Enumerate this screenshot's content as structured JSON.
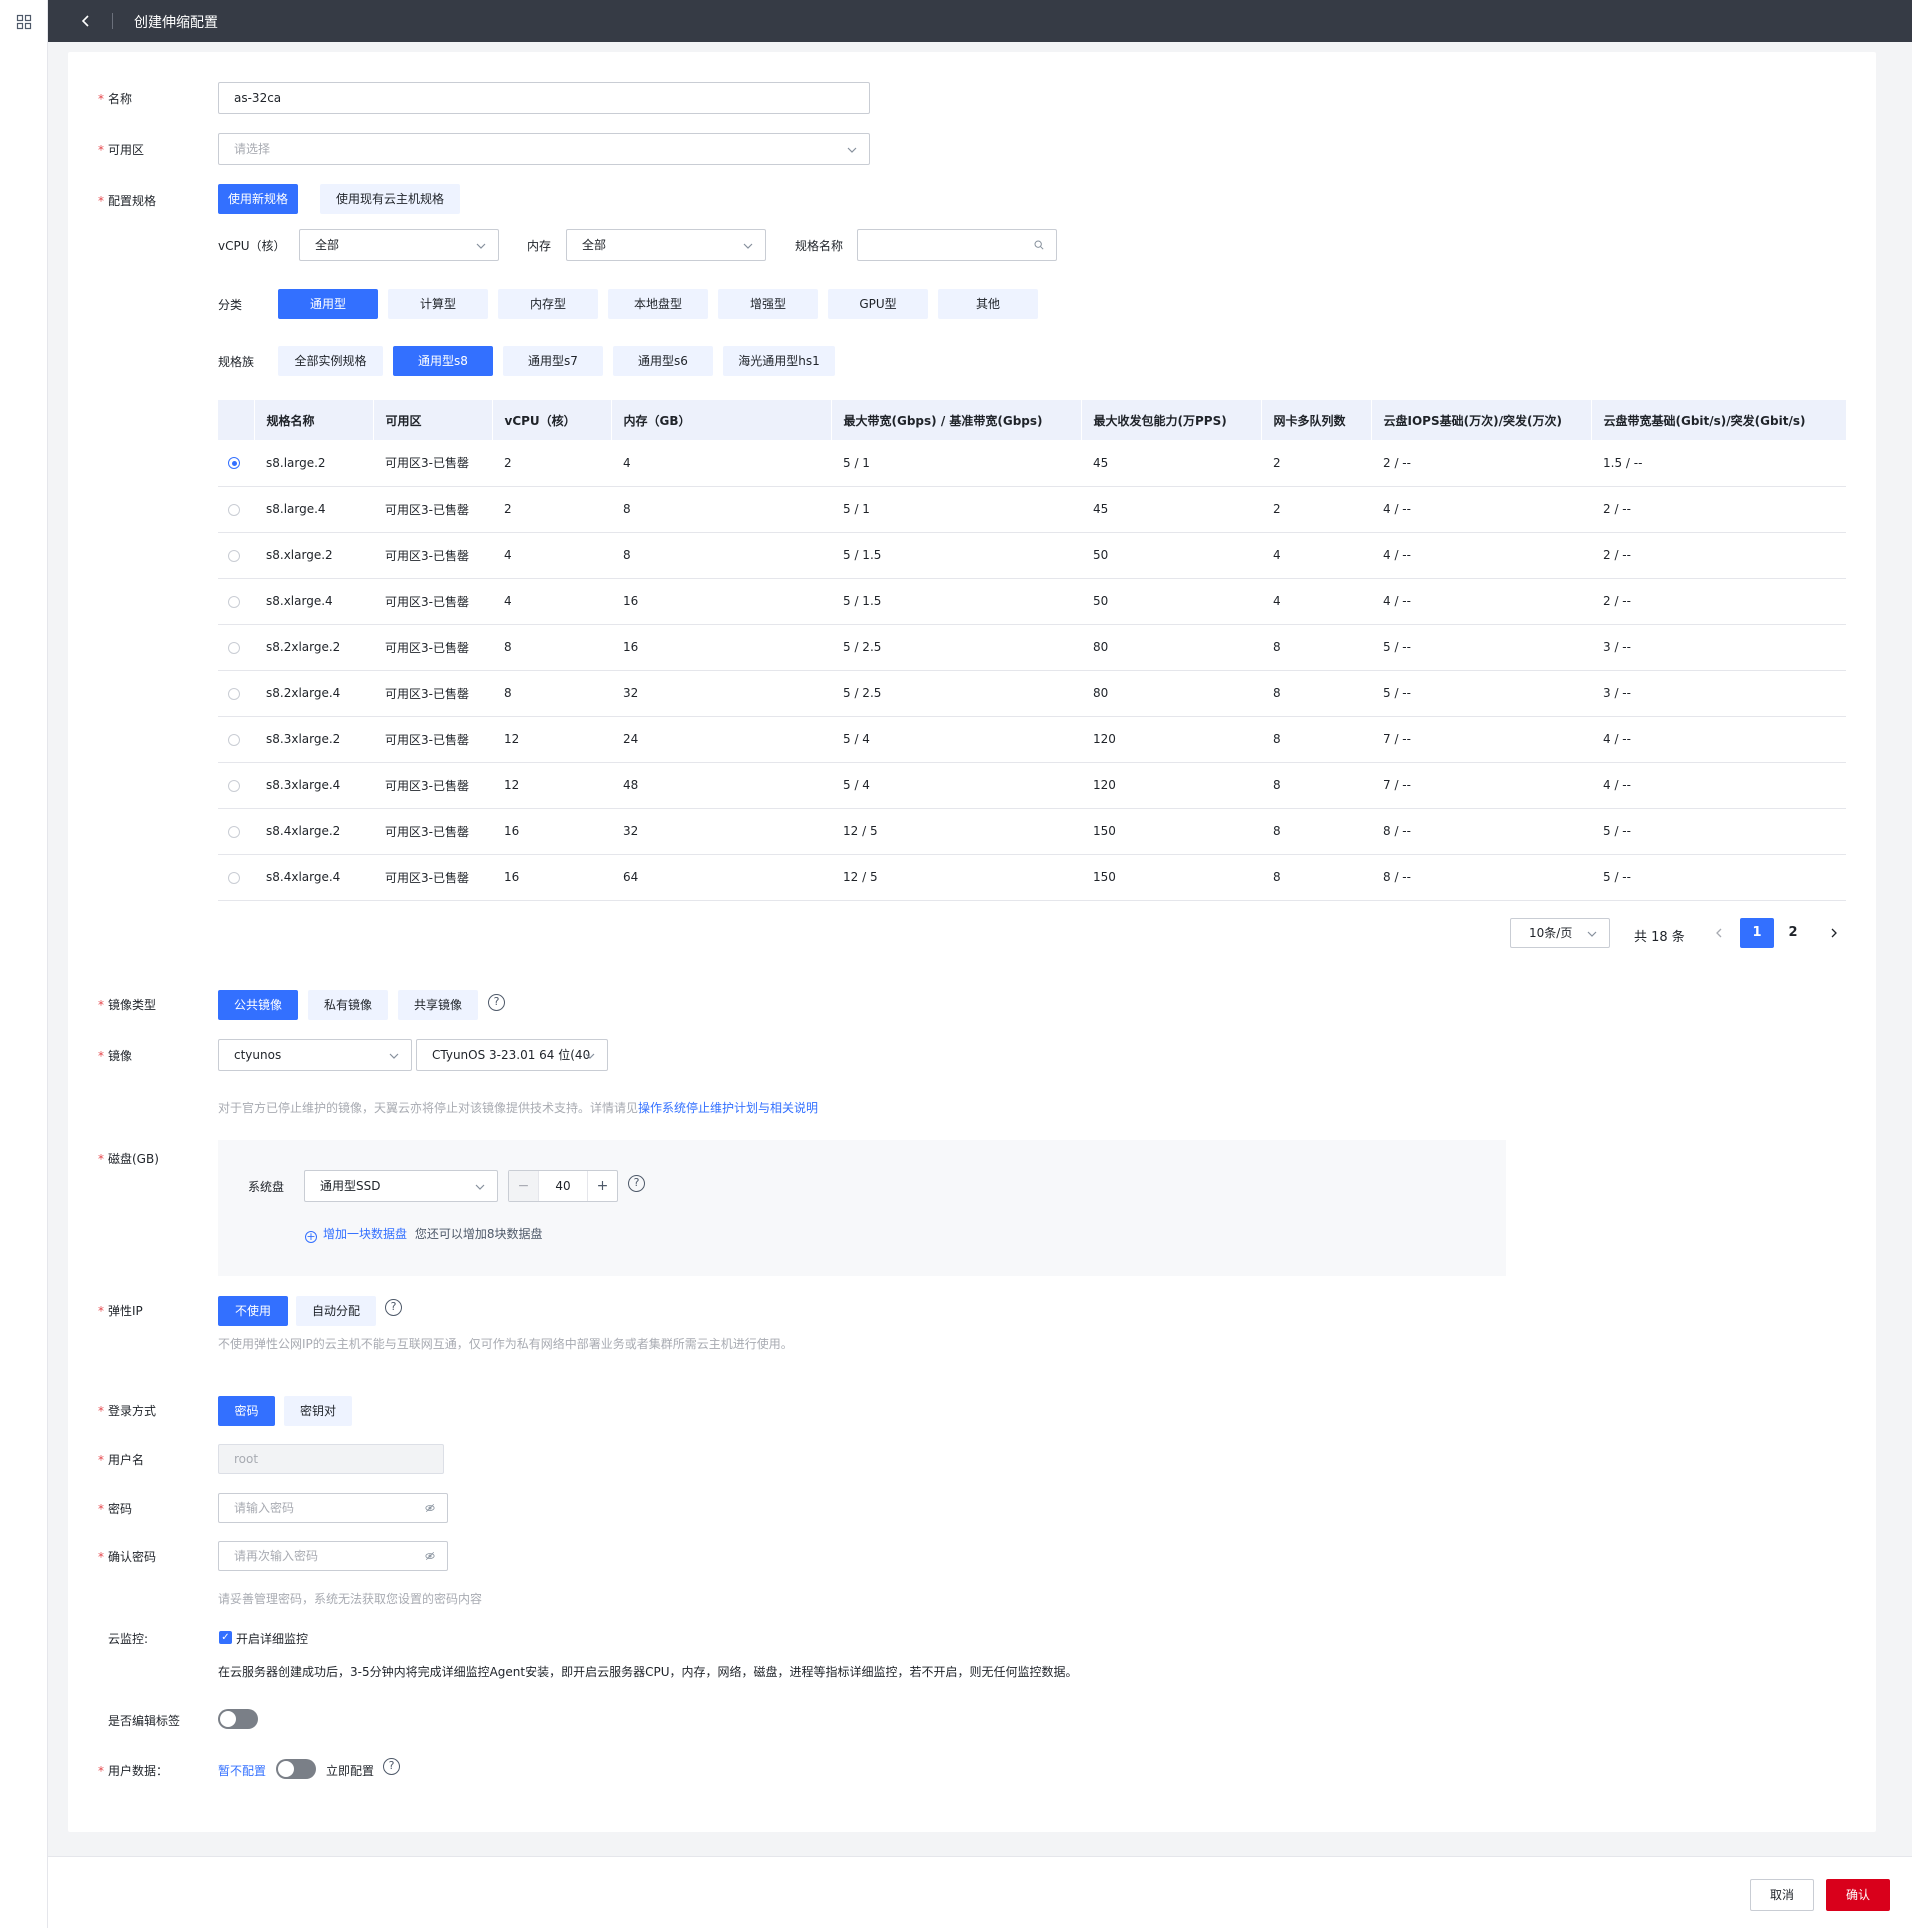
{
  "topbar": {
    "title": "创建伸缩配置"
  },
  "form": {
    "name_label": "名称",
    "name_value": "as-32ca",
    "zone_label": "可用区",
    "zone_placeholder": "请选择",
    "spec_label": "配置规格",
    "spec_modes": [
      "使用新规格",
      "使用现有云主机规格"
    ],
    "filters": {
      "vcpu_label": "vCPU（核）",
      "vcpu_value": "全部",
      "mem_label": "内存",
      "mem_value": "全部",
      "specname_label": "规格名称"
    },
    "category_label": "分类",
    "categories": [
      "通用型",
      "计算型",
      "内存型",
      "本地盘型",
      "增强型",
      "GPU型",
      "其他"
    ],
    "family_label": "规格族",
    "families": [
      "全部实例规格",
      "通用型s8",
      "通用型s7",
      "通用型s6",
      "海光通用型hs1"
    ]
  },
  "table": {
    "headers": [
      "规格名称",
      "可用区",
      "vCPU（核）",
      "内存（GB）",
      "最大带宽(Gbps) / 基准带宽(Gbps)",
      "最大收发包能力(万PPS)",
      "网卡多队列数",
      "云盘IOPS基础(万次)/突发(万次)",
      "云盘带宽基础(Gbit/s)/突发(Gbit/s)"
    ],
    "rows": [
      [
        "s8.large.2",
        "可用区3-已售罄",
        "2",
        "4",
        "5 / 1",
        "45",
        "2",
        "2 / --",
        "1.5 / --"
      ],
      [
        "s8.large.4",
        "可用区3-已售罄",
        "2",
        "8",
        "5 / 1",
        "45",
        "2",
        "4 / --",
        "2 / --"
      ],
      [
        "s8.xlarge.2",
        "可用区3-已售罄",
        "4",
        "8",
        "5 / 1.5",
        "50",
        "4",
        "4 / --",
        "2 / --"
      ],
      [
        "s8.xlarge.4",
        "可用区3-已售罄",
        "4",
        "16",
        "5 / 1.5",
        "50",
        "4",
        "4 / --",
        "2 / --"
      ],
      [
        "s8.2xlarge.2",
        "可用区3-已售罄",
        "8",
        "16",
        "5 / 2.5",
        "80",
        "8",
        "5 / --",
        "3 / --"
      ],
      [
        "s8.2xlarge.4",
        "可用区3-已售罄",
        "8",
        "32",
        "5 / 2.5",
        "80",
        "8",
        "5 / --",
        "3 / --"
      ],
      [
        "s8.3xlarge.2",
        "可用区3-已售罄",
        "12",
        "24",
        "5 / 4",
        "120",
        "8",
        "7 / --",
        "4 / --"
      ],
      [
        "s8.3xlarge.4",
        "可用区3-已售罄",
        "12",
        "48",
        "5 / 4",
        "120",
        "8",
        "7 / --",
        "4 / --"
      ],
      [
        "s8.4xlarge.2",
        "可用区3-已售罄",
        "16",
        "32",
        "12 / 5",
        "150",
        "8",
        "8 / --",
        "5 / --"
      ],
      [
        "s8.4xlarge.4",
        "可用区3-已售罄",
        "16",
        "64",
        "12 / 5",
        "150",
        "8",
        "8 / --",
        "5 / --"
      ]
    ],
    "selected_row": 0
  },
  "pager": {
    "page_size": "10条/页",
    "total": "共 18 条",
    "pages": [
      "1",
      "2"
    ]
  },
  "image": {
    "type_label": "镜像类型",
    "types": [
      "公共镜像",
      "私有镜像",
      "共享镜像"
    ],
    "image_label": "镜像",
    "os_value": "ctyunos",
    "version_value": "CTyunOS 3-23.01 64 位(40",
    "notice_text": "对于官方已停止维护的镜像，天翼云亦将停止对该镜像提供技术支持。详情请见",
    "notice_link": "操作系统停止维护计划与相关说明"
  },
  "disk": {
    "label": "磁盘(GB)",
    "sys_label": "系统盘",
    "sys_type": "通用型SSD",
    "size": "40",
    "minus": "−",
    "plus": "+",
    "add_link": "增加一块数据盘",
    "add_hint": "您还可以增加8块数据盘"
  },
  "eip": {
    "label": "弹性IP",
    "options": [
      "不使用",
      "自动分配"
    ],
    "hint": "不使用弹性公网IP的云主机不能与互联网互通，仅可作为私有网络中部署业务或者集群所需云主机进行使用。"
  },
  "login": {
    "label": "登录方式",
    "options": [
      "密码",
      "密钥对"
    ],
    "user_label": "用户名",
    "user_value": "root",
    "pwd_label": "密码",
    "pwd_placeholder": "请输入密码",
    "confirm_label": "确认密码",
    "confirm_placeholder": "请再次输入密码",
    "hint": "请妥善管理密码，系统无法获取您设置的密码内容"
  },
  "monitor": {
    "label": "云监控:",
    "checkbox_label": "开启详细监控",
    "desc": "在云服务器创建成功后，3-5分钟内将完成详细监控Agent安装，即开启云服务器CPU，内存，网络，磁盘，进程等指标详细监控，若不开启，则无任何监控数据。"
  },
  "tags": {
    "label": "是否编辑标签"
  },
  "userdata": {
    "label": "用户数据：",
    "off_text": "暂不配置",
    "on_text": "立即配置"
  },
  "footer": {
    "cancel": "取消",
    "confirm": "确认"
  }
}
